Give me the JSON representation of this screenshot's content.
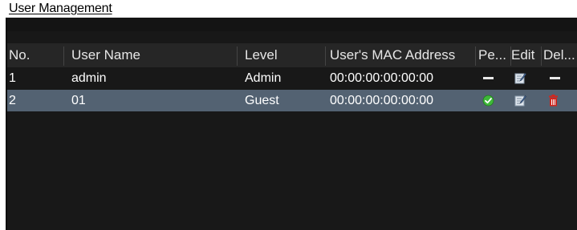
{
  "title": "User Management",
  "columns": {
    "no": "No.",
    "user_name": "User Name",
    "level": "Level",
    "mac": "User's MAC Address",
    "permission": "Pe...",
    "edit": "Edit",
    "delete": "Del..."
  },
  "rows": [
    {
      "no": "1",
      "user_name": "admin",
      "level": "Admin",
      "mac": "00:00:00:00:00:00",
      "permission_icon": "dash-icon",
      "edit_icon": "edit-icon",
      "delete_icon": "dash-icon",
      "selected": false
    },
    {
      "no": "2",
      "user_name": "01",
      "level": "Guest",
      "mac": "00:00:00:00:00:00",
      "permission_icon": "check-circle-icon",
      "edit_icon": "edit-icon",
      "delete_icon": "trash-icon",
      "selected": true
    }
  ],
  "colors": {
    "panel_background": "#181818",
    "header_background": "#262626",
    "selected_row": "#536272",
    "check_green": "#3fb83a",
    "delete_red": "#d0271f"
  }
}
